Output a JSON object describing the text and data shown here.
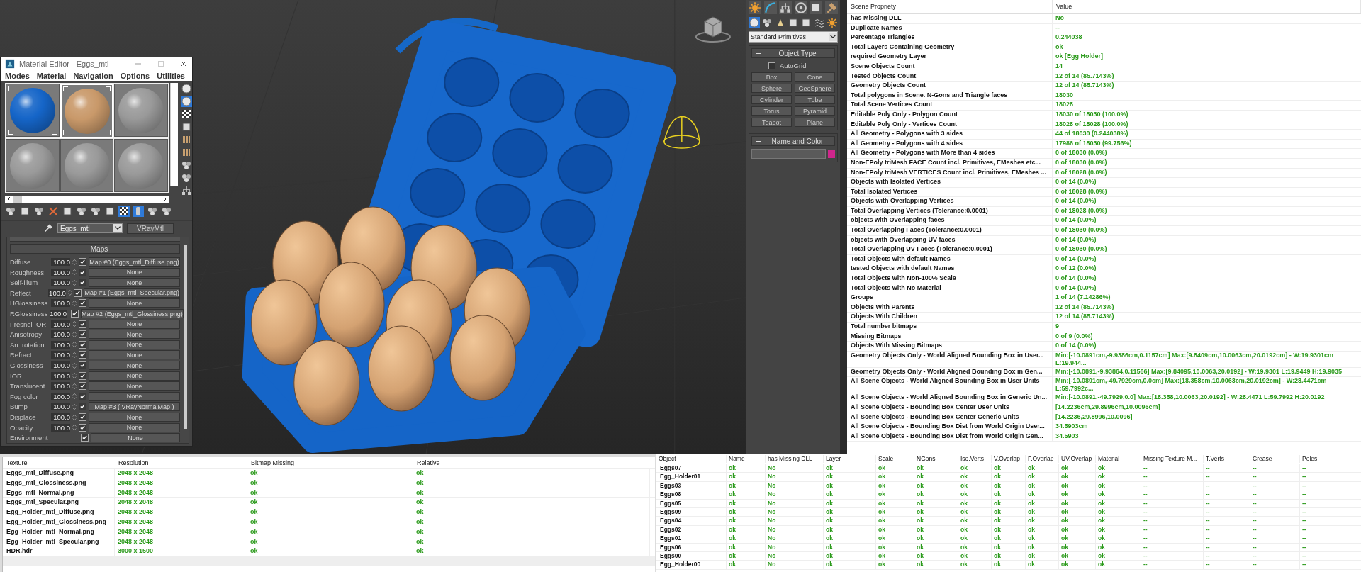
{
  "material_editor": {
    "title": "Material Editor - Eggs_mtl",
    "menu": [
      "Modes",
      "Material",
      "Navigation",
      "Options",
      "Utilities"
    ],
    "sample_slots": [
      {
        "color": "#1565c8",
        "selected": false,
        "in_scene": true
      },
      {
        "color": "#c9996a",
        "selected": true,
        "in_scene": true
      },
      {
        "color": "#9a9a9a",
        "selected": false,
        "in_scene": false
      },
      {
        "color": "#9a9a9a",
        "selected": false,
        "in_scene": false
      },
      {
        "color": "#9a9a9a",
        "selected": false,
        "in_scene": false
      },
      {
        "color": "#9a9a9a",
        "selected": false,
        "in_scene": false
      }
    ],
    "material_name": "Eggs_mtl",
    "material_type": "VRayMtl",
    "rollout_title": "Maps",
    "maps": [
      {
        "label": "Diffuse",
        "amount": "100.0",
        "checked": true,
        "map": "Map #0 (Eggs_mtl_Diffuse.png)"
      },
      {
        "label": "Roughness",
        "amount": "100.0",
        "checked": true,
        "map": "None"
      },
      {
        "label": "Self-illum",
        "amount": "100.0",
        "checked": true,
        "map": "None"
      },
      {
        "label": "Reflect",
        "amount": "100.0",
        "checked": true,
        "map": "Map #1 (Eggs_mtl_Specular.png)"
      },
      {
        "label": "HGlossiness",
        "amount": "100.0",
        "checked": true,
        "map": "None"
      },
      {
        "label": "RGlossiness",
        "amount": "100.0",
        "checked": true,
        "map": "Map #2 (Eggs_mtl_Glossiness.png)"
      },
      {
        "label": "Fresnel IOR",
        "amount": "100.0",
        "checked": true,
        "map": "None"
      },
      {
        "label": "Anisotropy",
        "amount": "100.0",
        "checked": true,
        "map": "None"
      },
      {
        "label": "An. rotation",
        "amount": "100.0",
        "checked": true,
        "map": "None"
      },
      {
        "label": "Refract",
        "amount": "100.0",
        "checked": true,
        "map": "None"
      },
      {
        "label": "Glossiness",
        "amount": "100.0",
        "checked": true,
        "map": "None"
      },
      {
        "label": "IOR",
        "amount": "100.0",
        "checked": true,
        "map": "None"
      },
      {
        "label": "Translucent",
        "amount": "100.0",
        "checked": true,
        "map": "None"
      },
      {
        "label": "Fog color",
        "amount": "100.0",
        "checked": true,
        "map": "None"
      },
      {
        "label": "Bump",
        "amount": "100.0",
        "checked": true,
        "map": "Map #3  ( VRayNormalMap )"
      },
      {
        "label": "Displace",
        "amount": "100.0",
        "checked": true,
        "map": "None"
      },
      {
        "label": "Opacity",
        "amount": "100.0",
        "checked": true,
        "map": "None"
      },
      {
        "label": "Environment",
        "checked": true,
        "map": "None"
      }
    ]
  },
  "command_panel": {
    "category": "Standard Primitives",
    "object_type": {
      "title": "Object Type",
      "autogrid_label": "AutoGrid",
      "autogrid_checked": false,
      "buttons": [
        "Box",
        "Cone",
        "Sphere",
        "GeoSphere",
        "Cylinder",
        "Tube",
        "Torus",
        "Pyramid",
        "Teapot",
        "Plane"
      ]
    },
    "name_and_color": {
      "title": "Name and Color",
      "color": "#d0268c"
    }
  },
  "scene_table": {
    "columns": [
      "Scene Propriety",
      "Value"
    ],
    "rows": [
      [
        "has Missing DLL",
        "No"
      ],
      [
        "Duplicate Names",
        "--"
      ],
      [
        "Percentage Triangles",
        "0.244038"
      ],
      [
        "Total Layers Containing Geometry",
        "ok"
      ],
      [
        "required Geometry Layer",
        "ok [Egg Holder]"
      ],
      [
        "Scene Objects Count",
        "14"
      ],
      [
        "Tested Objects Count",
        "12 of 14 (85.7143%)"
      ],
      [
        "Geometry Objects Count",
        "12 of 14 (85.7143%)"
      ],
      [
        "Total polygons in Scene. N-Gons and Triangle faces",
        "18030"
      ],
      [
        "Total Scene Vertices Count",
        "18028"
      ],
      [
        "Editable Poly Only - Polygon Count",
        "18030 of 18030 (100.0%)"
      ],
      [
        "Editable Poly Only - Vertices Count",
        "18028 of 18028 (100.0%)"
      ],
      [
        "All Geometry - Polygons with 3 sides",
        "44 of 18030 (0.244038%)"
      ],
      [
        "All Geometry - Polygons with 4 sides",
        "17986 of 18030 (99.756%)"
      ],
      [
        "All Geometry - Polygons with More than 4 sides",
        "0 of 18030 (0.0%)"
      ],
      [
        "Non-EPoly triMesh FACE Count incl. Primitives, EMeshes etc...",
        "0 of 18030 (0.0%)"
      ],
      [
        "Non-EPoly triMesh VERTICES Count incl. Primitives, EMeshes ...",
        "0 of 18028 (0.0%)"
      ],
      [
        "Objects with Isolated Vertices",
        "0 of 14 (0.0%)"
      ],
      [
        "Total Isolated Vertices",
        "0 of 18028 (0.0%)"
      ],
      [
        "Objects with Overlapping Vertices",
        "0 of 14 (0.0%)"
      ],
      [
        "Total Overlapping Vertices (Tolerance:0.0001)",
        "0 of 18028 (0.0%)"
      ],
      [
        "objects with Overlapping faces",
        "0 of 14 (0.0%)"
      ],
      [
        "Total Overlapping Faces (Tolerance:0.0001)",
        "0 of 18030 (0.0%)"
      ],
      [
        "objects with Overlapping UV faces",
        "0 of 14 (0.0%)"
      ],
      [
        "Total Overlapping UV Faces (Tolerance:0.0001)",
        "0 of 18030 (0.0%)"
      ],
      [
        "Total Objects with default Names",
        "0 of 14 (0.0%)"
      ],
      [
        "tested Objects with default Names",
        "0 of 12 (0.0%)"
      ],
      [
        "Total Objects with Non-100% Scale",
        "0 of 14 (0.0%)"
      ],
      [
        "Total Objects with No Material",
        "0 of 14 (0.0%)"
      ],
      [
        "Groups",
        "1 of 14 (7.14286%)"
      ],
      [
        "Objects With Parents",
        "12 of 14 (85.7143%)"
      ],
      [
        "Objects With Children",
        "12 of 14 (85.7143%)"
      ],
      [
        "Total number bitmaps",
        "9"
      ],
      [
        "Missing Bitmaps",
        "0 of 9 (0.0%)"
      ],
      [
        "Objects With Missing Bitmaps",
        "0 of 14 (0.0%)"
      ],
      [
        "Geometry Objects Only - World Aligned Bounding Box in User...",
        "Min:[-10.0891cm,-9.9386cm,0.1157cm]  Max:[9.8409cm,10.0063cm,20.0192cm] - W:19.9301cm L:19.944..."
      ],
      [
        "Geometry Objects Only - World Aligned Bounding Box in Gen...",
        "Min:[-10.0891,-9.93864,0.11566]  Max:[9.84095,10.0063,20.0192] - W:19.9301 L:19.9449 H:19.9035"
      ],
      [
        "All Scene Objects - World Aligned Bounding Box in User Units",
        "Min:[-10.0891cm,-49.7929cm,0.0cm]  Max:[18.358cm,10.0063cm,20.0192cm] - W:28.4471cm L:59.7992c..."
      ],
      [
        "All Scene Objects - World Aligned Bounding Box in Generic Un...",
        "Min:[-10.0891,-49.7929,0.0]  Max:[18.358,10.0063,20.0192] - W:28.4471 L:59.7992 H:20.0192"
      ],
      [
        "All Scene Objects - Bounding Box Center User Units",
        "[14.2236cm,29.8996cm,10.0096cm]"
      ],
      [
        "All Scene Objects - Bounding Box Center Generic Units",
        "[14.2236,29.8996,10.0096]"
      ],
      [
        "All Scene Objects - Bounding Box Dist from World Origin User...",
        "34.5903cm"
      ],
      [
        "All Scene Objects - Bounding Box Dist from World Origin Gen...",
        "34.5903"
      ]
    ]
  },
  "texture_table": {
    "columns": [
      "Texture",
      "Resolution",
      "Bitmap Missing",
      "Relative"
    ],
    "rows": [
      [
        "Eggs_mtl_Diffuse.png",
        "2048 x 2048",
        "ok",
        "ok"
      ],
      [
        "Eggs_mtl_Glossiness.png",
        "2048 x 2048",
        "ok",
        "ok"
      ],
      [
        "Eggs_mtl_Normal.png",
        "2048 x 2048",
        "ok",
        "ok"
      ],
      [
        "Eggs_mtl_Specular.png",
        "2048 x 2048",
        "ok",
        "ok"
      ],
      [
        "Egg_Holder_mtl_Diffuse.png",
        "2048 x 2048",
        "ok",
        "ok"
      ],
      [
        "Egg_Holder_mtl_Glossiness.png",
        "2048 x 2048",
        "ok",
        "ok"
      ],
      [
        "Egg_Holder_mtl_Normal.png",
        "2048 x 2048",
        "ok",
        "ok"
      ],
      [
        "Egg_Holder_mtl_Specular.png",
        "2048 x 2048",
        "ok",
        "ok"
      ],
      [
        "HDR.hdr",
        "3000 x 1500",
        "ok",
        "ok"
      ]
    ]
  },
  "object_table": {
    "columns": [
      "Object",
      "Name",
      "has Missing DLL",
      "Layer",
      "Scale",
      "NGons",
      "Iso.Verts",
      "V.Overlap",
      "F.Overlap",
      "UV.Overlap",
      "Material",
      "Missing Texture M...",
      "T.Verts",
      "Crease",
      "Poles"
    ],
    "rows": [
      [
        "Eggs07",
        "ok",
        "No",
        "ok",
        "ok",
        "ok",
        "ok",
        "ok",
        "ok",
        "ok",
        "ok",
        "--",
        "--",
        "--",
        "--"
      ],
      [
        "Egg_Holder01",
        "ok",
        "No",
        "ok",
        "ok",
        "ok",
        "ok",
        "ok",
        "ok",
        "ok",
        "ok",
        "--",
        "--",
        "--",
        "--"
      ],
      [
        "Eggs03",
        "ok",
        "No",
        "ok",
        "ok",
        "ok",
        "ok",
        "ok",
        "ok",
        "ok",
        "ok",
        "--",
        "--",
        "--",
        "--"
      ],
      [
        "Eggs08",
        "ok",
        "No",
        "ok",
        "ok",
        "ok",
        "ok",
        "ok",
        "ok",
        "ok",
        "ok",
        "--",
        "--",
        "--",
        "--"
      ],
      [
        "Eggs05",
        "ok",
        "No",
        "ok",
        "ok",
        "ok",
        "ok",
        "ok",
        "ok",
        "ok",
        "ok",
        "--",
        "--",
        "--",
        "--"
      ],
      [
        "Eggs09",
        "ok",
        "No",
        "ok",
        "ok",
        "ok",
        "ok",
        "ok",
        "ok",
        "ok",
        "ok",
        "--",
        "--",
        "--",
        "--"
      ],
      [
        "Eggs04",
        "ok",
        "No",
        "ok",
        "ok",
        "ok",
        "ok",
        "ok",
        "ok",
        "ok",
        "ok",
        "--",
        "--",
        "--",
        "--"
      ],
      [
        "Eggs02",
        "ok",
        "No",
        "ok",
        "ok",
        "ok",
        "ok",
        "ok",
        "ok",
        "ok",
        "ok",
        "--",
        "--",
        "--",
        "--"
      ],
      [
        "Eggs01",
        "ok",
        "No",
        "ok",
        "ok",
        "ok",
        "ok",
        "ok",
        "ok",
        "ok",
        "ok",
        "--",
        "--",
        "--",
        "--"
      ],
      [
        "Eggs06",
        "ok",
        "No",
        "ok",
        "ok",
        "ok",
        "ok",
        "ok",
        "ok",
        "ok",
        "ok",
        "--",
        "--",
        "--",
        "--"
      ],
      [
        "Eggs00",
        "ok",
        "No",
        "ok",
        "ok",
        "ok",
        "ok",
        "ok",
        "ok",
        "ok",
        "ok",
        "--",
        "--",
        "--",
        "--"
      ],
      [
        "Egg_Holder00",
        "ok",
        "No",
        "ok",
        "ok",
        "ok",
        "ok",
        "ok",
        "ok",
        "ok",
        "ok",
        "--",
        "--",
        "--",
        "--"
      ]
    ]
  }
}
